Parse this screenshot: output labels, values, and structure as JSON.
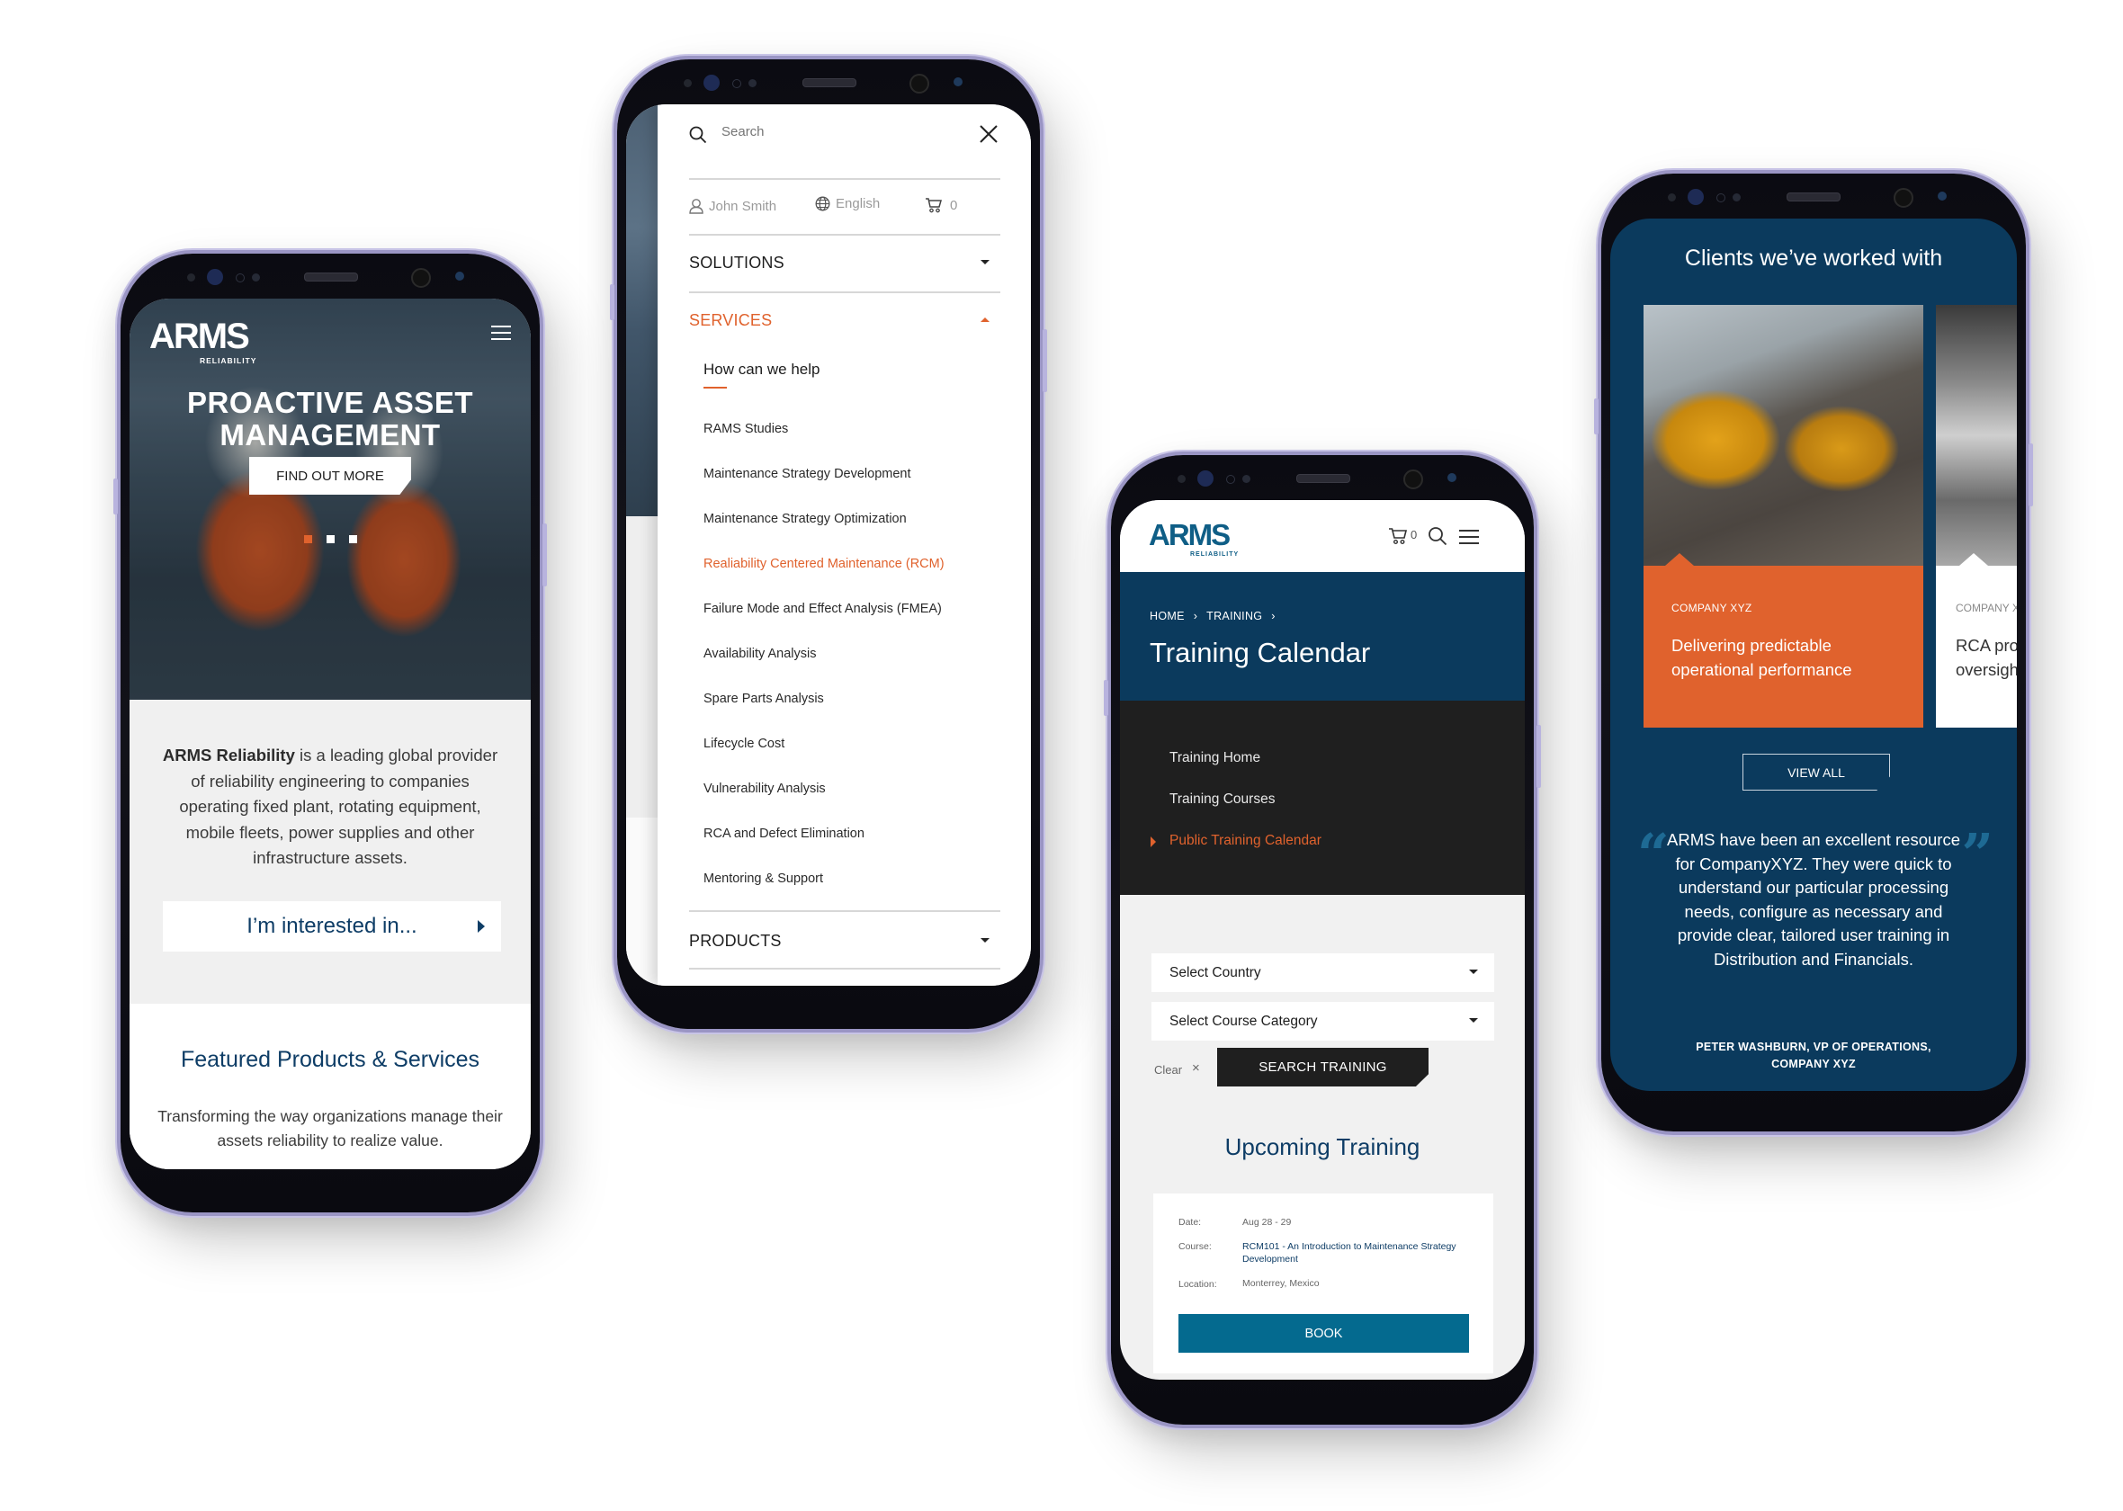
{
  "brand": {
    "name": "ARMS",
    "tagline": "RELIABILITY",
    "colors": {
      "navy": "#0b3a5d",
      "orange": "#e0622d",
      "teal_button": "#046a8f",
      "dark": "#1f1f1f",
      "light_gray": "#f0f0f0"
    }
  },
  "home_screen": {
    "menu_icon": "hamburger-icon",
    "hero": {
      "title_line1": "PROACTIVE ASSET",
      "title_line2": "MANAGEMENT",
      "cta_label": "FIND OUT MORE",
      "carousel": {
        "total": 3,
        "active_index": 0
      }
    },
    "intro": {
      "bold_lead": "ARMS Reliability",
      "body": " is a leading global provider of reliability engineering to companies operating fixed plant, rotating equipment, mobile fleets, power supplies and other infrastructure assets."
    },
    "interest_dropdown": {
      "label": "I’m interested in...",
      "icon": "caret-right-icon"
    },
    "featured": {
      "title": "Featured Products & Services",
      "subtitle": "Transforming the way organizations manage their assets reliability to realize value."
    }
  },
  "menu_screen": {
    "search": {
      "placeholder": "Search",
      "icon": "search-icon",
      "close_icon": "close-icon"
    },
    "utilities": {
      "user": "John Smith",
      "language": "English",
      "cart_count": "0"
    },
    "sections": [
      {
        "label": "SOLUTIONS",
        "expanded": false
      },
      {
        "label": "SERVICES",
        "expanded": true
      },
      {
        "label": "PRODUCTS",
        "expanded": false
      }
    ],
    "services_heading": "How can we help",
    "services_items": [
      {
        "label": "RAMS Studies",
        "active": false
      },
      {
        "label": "Maintenance Strategy Development",
        "active": false
      },
      {
        "label": "Maintenance Strategy Optimization",
        "active": false
      },
      {
        "label": "Realiability Centered Maintenance (RCM)",
        "active": true
      },
      {
        "label": "Failure Mode and Effect Analysis (FMEA)",
        "active": false
      },
      {
        "label": "Availability Analysis",
        "active": false
      },
      {
        "label": "Spare Parts Analysis",
        "active": false
      },
      {
        "label": "Lifecycle Cost",
        "active": false
      },
      {
        "label": "Vulnerability Analysis",
        "active": false
      },
      {
        "label": "RCA and Defect Elimination",
        "active": false
      },
      {
        "label": "Mentoring & Support",
        "active": false
      }
    ]
  },
  "training_screen": {
    "header": {
      "cart_count": "0"
    },
    "breadcrumb": [
      "HOME",
      "TRAINING"
    ],
    "breadcrumb_separator": "›",
    "title": "Training Calendar",
    "subnav": [
      {
        "label": "Training Home",
        "active": false
      },
      {
        "label": "Training Courses",
        "active": false
      },
      {
        "label": "Public Training Calendar",
        "active": true
      }
    ],
    "filters": {
      "country": "Select Country",
      "category": "Select Course Category",
      "clear_label": "Clear",
      "clear_icon": "×",
      "search_label": "SEARCH TRAINING"
    },
    "upcoming_title": "Upcoming Training",
    "course_card": {
      "date_label": "Date:",
      "date": "Aug 28 - 29",
      "course_label": "Course:",
      "course": "RCM101 - An Introduction to Maintenance Strategy Development",
      "location_label": "Location:",
      "location": "Monterrey, Mexico",
      "book_label": "BOOK"
    }
  },
  "clients_screen": {
    "title": "Clients we’ve worked with",
    "cards": [
      {
        "kicker": "COMPANY XYZ",
        "headline": "Delivering predictable operational performance"
      },
      {
        "kicker": "COMPANY XYZ",
        "headline": "RCA program development and oversight"
      }
    ],
    "view_all_label": "VIEW ALL",
    "testimonial": {
      "open_quote": "“",
      "close_quote": "”",
      "text": "ARMS have been an excellent resource for CompanyXYZ. They were quick to understand our particular processing needs, configure as necessary and provide clear, tailored user training in Distribution and Financials.",
      "author_line1": "PETER WASHBURN, VP OF OPERATIONS,",
      "author_line2": "COMPANY XYZ"
    }
  }
}
